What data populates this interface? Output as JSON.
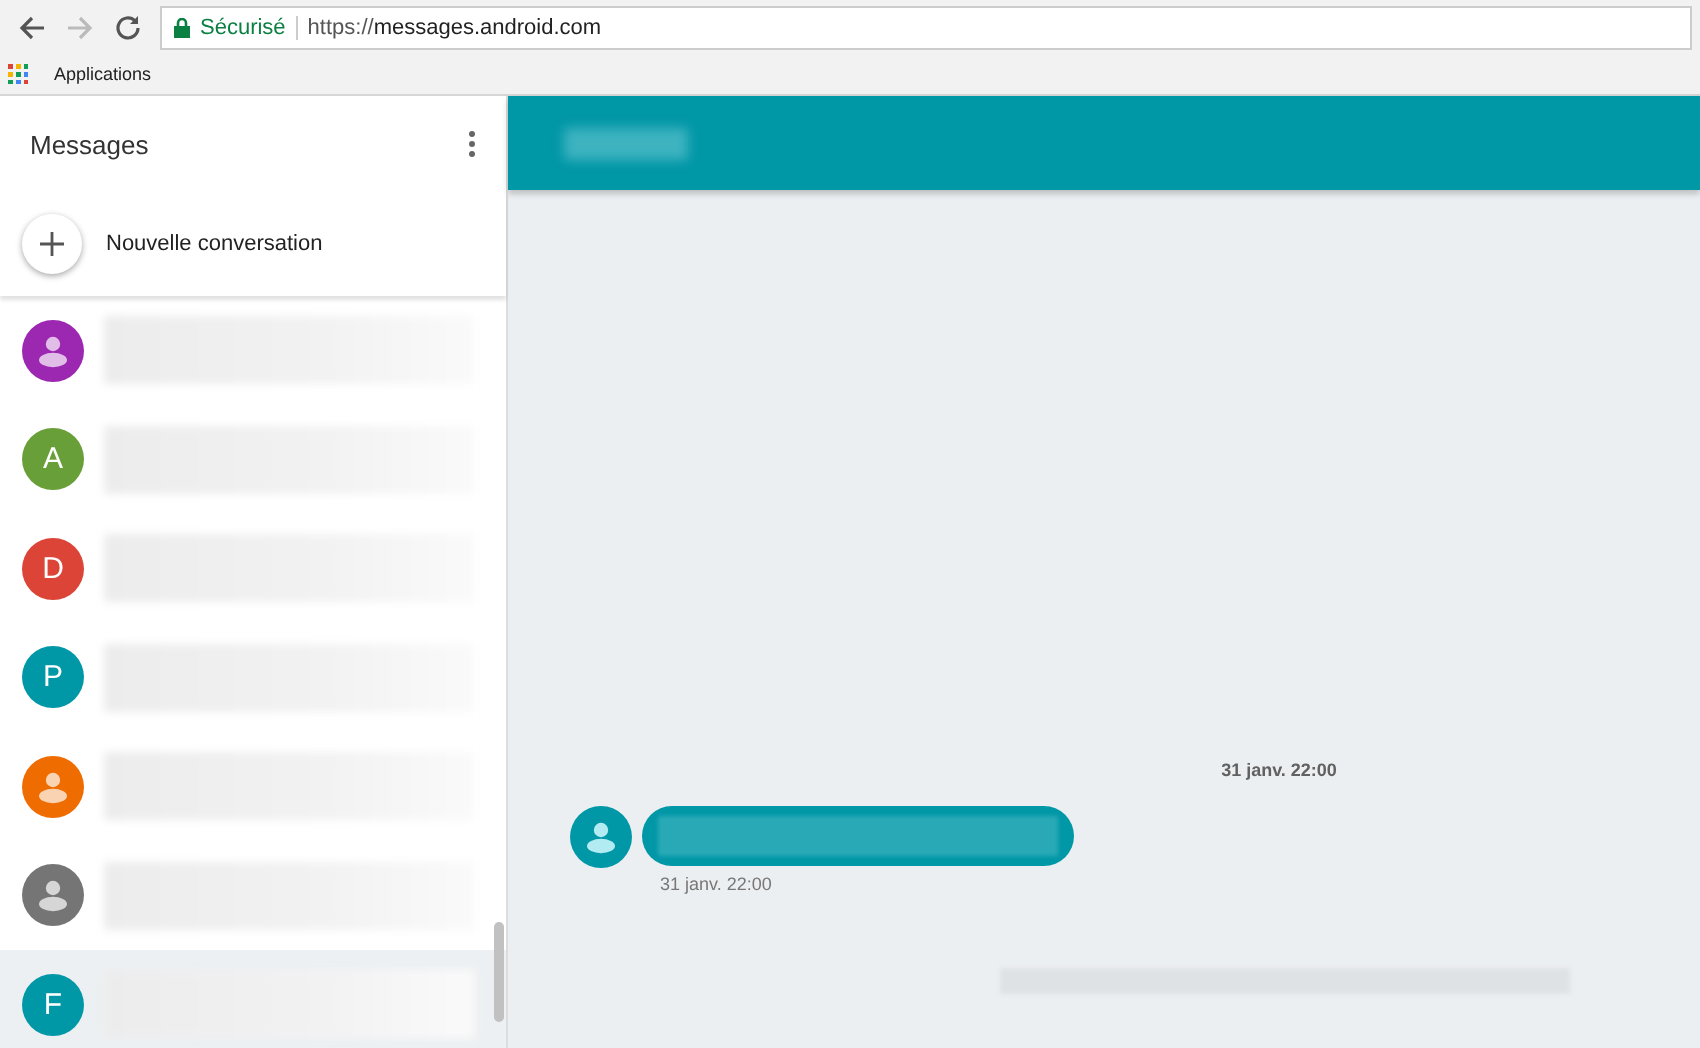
{
  "browser": {
    "security_label": "Sécurisé",
    "url_scheme": "https://",
    "url_host": "messages.android.com",
    "bookmarks": [
      "Applications"
    ]
  },
  "sidebar": {
    "title": "Messages",
    "new_conversation": "Nouvelle conversation",
    "conversations": [
      {
        "kind": "person",
        "color": "#9c27b0",
        "selected": false
      },
      {
        "kind": "letter",
        "letter": "A",
        "color": "#689f38",
        "selected": false
      },
      {
        "kind": "letter",
        "letter": "D",
        "color": "#db4437",
        "selected": false
      },
      {
        "kind": "letter",
        "letter": "P",
        "color": "#0097a7",
        "selected": false
      },
      {
        "kind": "person",
        "color": "#ef6c00",
        "selected": false
      },
      {
        "kind": "person",
        "color": "#757575",
        "selected": false
      },
      {
        "kind": "letter",
        "letter": "F",
        "color": "#0097a7",
        "selected": true
      }
    ]
  },
  "thread": {
    "date_divider": "31 janv. 22:00",
    "messages": [
      {
        "time": "31 janv. 22:00"
      }
    ]
  }
}
